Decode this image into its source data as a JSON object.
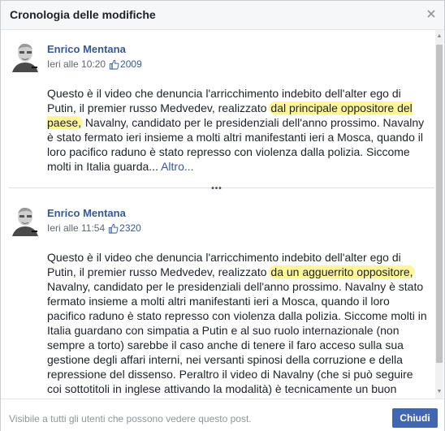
{
  "dialog": {
    "title": "Cronologia delle modifiche",
    "close_icon": "close-icon"
  },
  "posts": [
    {
      "author": "Enrico Mentana",
      "time": "Ieri alle 10:20",
      "likes": "2009",
      "text_before": "Questo è il video che denuncia l'arricchimento indebito dell'alter ego di Putin, il premier russo Medvedev, realizzato ",
      "highlight": "dal principale oppositore del paese,",
      "text_after": " Navalny, candidato per le presidenziali dell'anno prossimo. Navalny è stato fermato ieri insieme a molti altri manifestanti ieri a Mosca, quando il loro pacifico raduno è stato represso con violenza dalla polizia. Siccome molti in Italia guarda... ",
      "more": "Altro..."
    },
    {
      "author": "Enrico Mentana",
      "time": "Ieri alle 11:54",
      "likes": "2320",
      "text_before": "Questo è il video che denuncia l'arricchimento indebito dell'alter ego di Putin, il premier russo Medvedev, realizzato ",
      "highlight": "da un agguerrito oppositore,",
      "text_after": " Navalny, candidato per le presidenziali dell'anno prossimo. Navalny è stato fermato insieme a molti altri manifestanti ieri a Mosca, quando il loro pacifico raduno è stato represso con violenza dalla polizia. Siccome molti in Italia guardano con simpatia a Putin e al suo ruolo internazionale (non sempre a torto) sarebbe il caso anche di tenere il faro acceso sulla sua gestione degli affari interni, nei versanti spinosi della corruzione e della repressione del dissenso. Peraltro il video di Navalny (che si può seguire coi sottotitoli in inglese attivando la modalità) è tecnicamente un buon"
    }
  ],
  "separator": "•••",
  "footer": {
    "visibility": "Visibile a tutti gli utenti che possono vedere questo post.",
    "close_button": "Chiudi"
  },
  "colors": {
    "accent": "#4267b2",
    "link": "#365899",
    "highlight": "#fff59a"
  }
}
